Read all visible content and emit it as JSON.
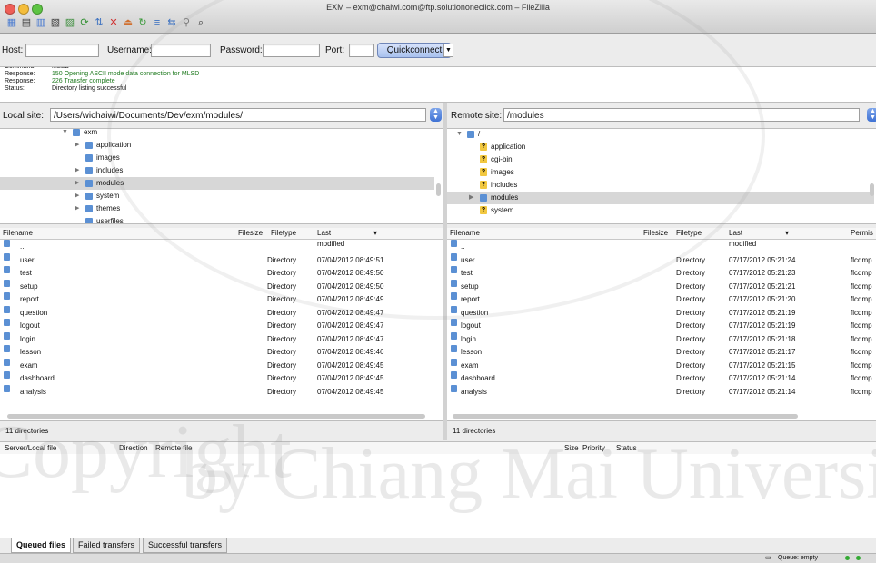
{
  "window": {
    "title": "EXM – exm@chaiwi.com@ftp.solutiononeclick.com – FileZilla"
  },
  "toolbar": {
    "icons": [
      "site-manager-icon",
      "toggle-log-icon",
      "toggle-local-tree-icon",
      "toggle-remote-tree-icon",
      "toggle-queue-icon",
      "refresh-icon",
      "process-queue-icon",
      "cancel-icon",
      "disconnect-icon",
      "reconnect-icon",
      "compare-icon",
      "sync-browse-icon",
      "filter-icon",
      "search-icon"
    ]
  },
  "quickconnect": {
    "host_label": "Host:",
    "username_label": "Username:",
    "password_label": "Password:",
    "port_label": "Port:",
    "button": "Quickconnect",
    "host_value": "",
    "username_value": "",
    "password_value": "",
    "port_value": ""
  },
  "log": [
    {
      "label": "Command:",
      "text": "MLSD",
      "kind": "normal"
    },
    {
      "label": "Response:",
      "text": "150 Opening ASCII mode data connection for MLSD",
      "kind": "green"
    },
    {
      "label": "Response:",
      "text": "226 Transfer complete",
      "kind": "green"
    },
    {
      "label": "Status:",
      "text": "Directory listing successful",
      "kind": "normal"
    }
  ],
  "local": {
    "site_label": "Local site:",
    "path": "/Users/wichaiwi/Documents/Dev/exm/modules/",
    "tree": [
      {
        "name": "exm",
        "expanded": true,
        "level": 0
      },
      {
        "name": "application",
        "level": 1
      },
      {
        "name": "images",
        "level": 1
      },
      {
        "name": "includes",
        "level": 1
      },
      {
        "name": "modules",
        "level": 1,
        "selected": true
      },
      {
        "name": "system",
        "level": 1
      },
      {
        "name": "themes",
        "level": 1
      },
      {
        "name": "userfiles",
        "level": 1
      }
    ],
    "columns": {
      "filename": "Filename",
      "filesize": "Filesize",
      "filetype": "Filetype",
      "modified": "Last modified"
    },
    "files": [
      {
        "name": "..",
        "type": "",
        "modified": ""
      },
      {
        "name": "user",
        "type": "Directory",
        "modified": "07/04/2012 08:49:51"
      },
      {
        "name": "test",
        "type": "Directory",
        "modified": "07/04/2012 08:49:50"
      },
      {
        "name": "setup",
        "type": "Directory",
        "modified": "07/04/2012 08:49:50"
      },
      {
        "name": "report",
        "type": "Directory",
        "modified": "07/04/2012 08:49:49"
      },
      {
        "name": "question",
        "type": "Directory",
        "modified": "07/04/2012 08:49:47"
      },
      {
        "name": "logout",
        "type": "Directory",
        "modified": "07/04/2012 08:49:47"
      },
      {
        "name": "login",
        "type": "Directory",
        "modified": "07/04/2012 08:49:47"
      },
      {
        "name": "lesson",
        "type": "Directory",
        "modified": "07/04/2012 08:49:46"
      },
      {
        "name": "exam",
        "type": "Directory",
        "modified": "07/04/2012 08:49:45"
      },
      {
        "name": "dashboard",
        "type": "Directory",
        "modified": "07/04/2012 08:49:45"
      },
      {
        "name": "analysis",
        "type": "Directory",
        "modified": "07/04/2012 08:49:45"
      }
    ],
    "status": "11 directories"
  },
  "remote": {
    "site_label": "Remote site:",
    "path": "/modules",
    "tree": [
      {
        "name": "/",
        "expanded": true,
        "level": 0,
        "icon": "folder"
      },
      {
        "name": "application",
        "level": 1,
        "icon": "unknown"
      },
      {
        "name": "cgi-bin",
        "level": 1,
        "icon": "unknown"
      },
      {
        "name": "images",
        "level": 1,
        "icon": "unknown"
      },
      {
        "name": "includes",
        "level": 1,
        "icon": "unknown"
      },
      {
        "name": "modules",
        "level": 1,
        "icon": "folder",
        "selected": true
      },
      {
        "name": "system",
        "level": 1,
        "icon": "unknown"
      }
    ],
    "columns": {
      "filename": "Filename",
      "filesize": "Filesize",
      "filetype": "Filetype",
      "modified": "Last modified",
      "permissions": "Permis"
    },
    "files": [
      {
        "name": "..",
        "type": "",
        "modified": "",
        "perm": ""
      },
      {
        "name": "user",
        "type": "Directory",
        "modified": "07/17/2012 05:21:24",
        "perm": "flcdmp"
      },
      {
        "name": "test",
        "type": "Directory",
        "modified": "07/17/2012 05:21:23",
        "perm": "flcdmp"
      },
      {
        "name": "setup",
        "type": "Directory",
        "modified": "07/17/2012 05:21:21",
        "perm": "flcdmp"
      },
      {
        "name": "report",
        "type": "Directory",
        "modified": "07/17/2012 05:21:20",
        "perm": "flcdmp"
      },
      {
        "name": "question",
        "type": "Directory",
        "modified": "07/17/2012 05:21:19",
        "perm": "flcdmp"
      },
      {
        "name": "logout",
        "type": "Directory",
        "modified": "07/17/2012 05:21:19",
        "perm": "flcdmp"
      },
      {
        "name": "login",
        "type": "Directory",
        "modified": "07/17/2012 05:21:18",
        "perm": "flcdmp"
      },
      {
        "name": "lesson",
        "type": "Directory",
        "modified": "07/17/2012 05:21:17",
        "perm": "flcdmp"
      },
      {
        "name": "exam",
        "type": "Directory",
        "modified": "07/17/2012 05:21:15",
        "perm": "flcdmp"
      },
      {
        "name": "dashboard",
        "type": "Directory",
        "modified": "07/17/2012 05:21:14",
        "perm": "flcdmp"
      },
      {
        "name": "analysis",
        "type": "Directory",
        "modified": "07/17/2012 05:21:14",
        "perm": "flcdmp"
      }
    ],
    "status": "11 directories"
  },
  "queue": {
    "columns": {
      "server_file": "Server/Local file",
      "direction": "Direction",
      "remote_file": "Remote file",
      "size": "Size",
      "priority": "Priority",
      "status": "Status"
    },
    "tabs": [
      "Queued files",
      "Failed transfers",
      "Successful transfers"
    ],
    "active_tab": 0
  },
  "statusbar": {
    "queue": "Queue: empty"
  },
  "watermark": {
    "line1": "Copyright",
    "line2": "by Chiang Mai University"
  },
  "colors": {
    "accent": "#3f72d4",
    "log_green": "#1f7a1f",
    "folder": "#5b90d4"
  }
}
